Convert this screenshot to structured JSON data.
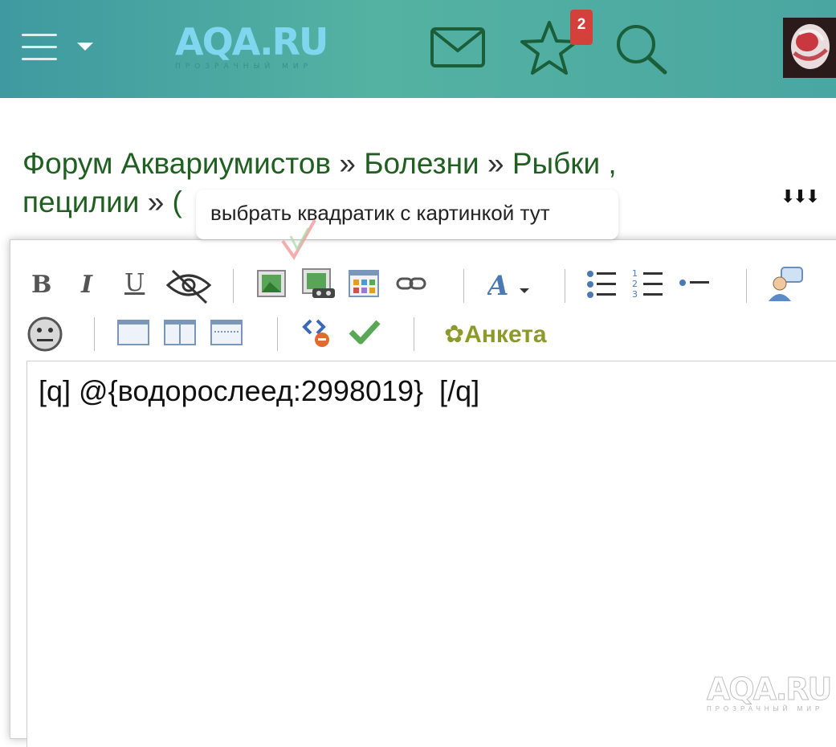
{
  "header": {
    "logo_text": "AQA.RU",
    "logo_subtitle": "ПРОЗРАЧНЫЙ МИР",
    "notifications_count": "2",
    "icons": [
      "menu-icon",
      "chevron-down-icon",
      "mail-icon",
      "star-icon",
      "search-icon",
      "avatar"
    ]
  },
  "breadcrumb": {
    "items": [
      "Форум Аквариумистов",
      "Болезни",
      "Рыбки ,",
      "пецилии"
    ],
    "separator": "»",
    "truncated_fragment": "(",
    "scroll_arrows": "⬇⬇⬇"
  },
  "tooltip": {
    "text": "выбрать квадратик с картинкой тут"
  },
  "toolbar": {
    "bold": "B",
    "italic": "I",
    "underline": "U",
    "anketa_label": "Анкета"
  },
  "editor": {
    "content": "[q] @{водорослеед:2998019}  [/q]"
  },
  "watermark": {
    "text": "AQA.RU",
    "subtitle": "ПРОЗРАЧНЫЙ МИР"
  },
  "colors": {
    "header_gradient_start": "#3e9aa0",
    "header_gradient_end": "#4aa6a1",
    "breadcrumb_link": "#1f5f1f",
    "badge": "#d2413b",
    "anketa": "#8c9a2a"
  }
}
